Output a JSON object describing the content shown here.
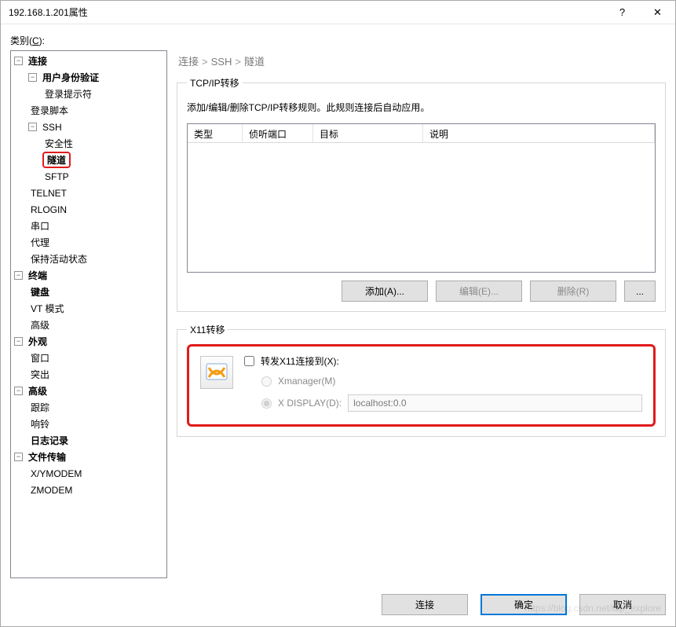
{
  "titlebar": {
    "title": "192.168.1.201属性",
    "help": "?",
    "close": "✕"
  },
  "category_label_pre": "类别(",
  "category_label_u": "C",
  "category_label_post": "):",
  "tree": {
    "connection": "连接",
    "user_auth": "用户身份验证",
    "login_prompt": "登录提示符",
    "login_script": "登录脚本",
    "ssh": "SSH",
    "security": "安全性",
    "tunnel": "隧道",
    "sftp": "SFTP",
    "telnet": "TELNET",
    "rlogin": "RLOGIN",
    "serial": "串口",
    "proxy": "代理",
    "keepalive": "保持活动状态",
    "terminal": "终端",
    "keyboard": "键盘",
    "vtmode": "VT 模式",
    "adv": "高级",
    "appearance": "外观",
    "window": "窗口",
    "highlight": "突出",
    "advanced": "高级",
    "trace": "跟踪",
    "bell": "响铃",
    "logging": "日志记录",
    "filetransfer": "文件传输",
    "xymodem": "X/YMODEM",
    "zmodem": "ZMODEM"
  },
  "breadcrumb": {
    "a": "连接",
    "b": "SSH",
    "c": "隧道"
  },
  "tcp": {
    "legend": "TCP/IP转移",
    "desc": "添加/编辑/删除TCP/IP转移规则。此规则连接后自动应用。",
    "cols": {
      "type": "类型",
      "port": "侦听端口",
      "target": "目标",
      "desc": "说明"
    },
    "btn_add": "添加(A)...",
    "btn_edit": "编辑(E)...",
    "btn_del": "删除(R)",
    "btn_more": "..."
  },
  "x11": {
    "legend": "X11转移",
    "forward_label": "转发X11连接到(X):",
    "opt_xmgr": "Xmanager(M)",
    "opt_xdisp": "X DISPLAY(D):",
    "xdisp_value": "localhost:0.0"
  },
  "footer": {
    "connect": "连接",
    "ok": "确定",
    "cancel": "取消"
  },
  "watermark": "https://blog.csdn.net/top_explore"
}
